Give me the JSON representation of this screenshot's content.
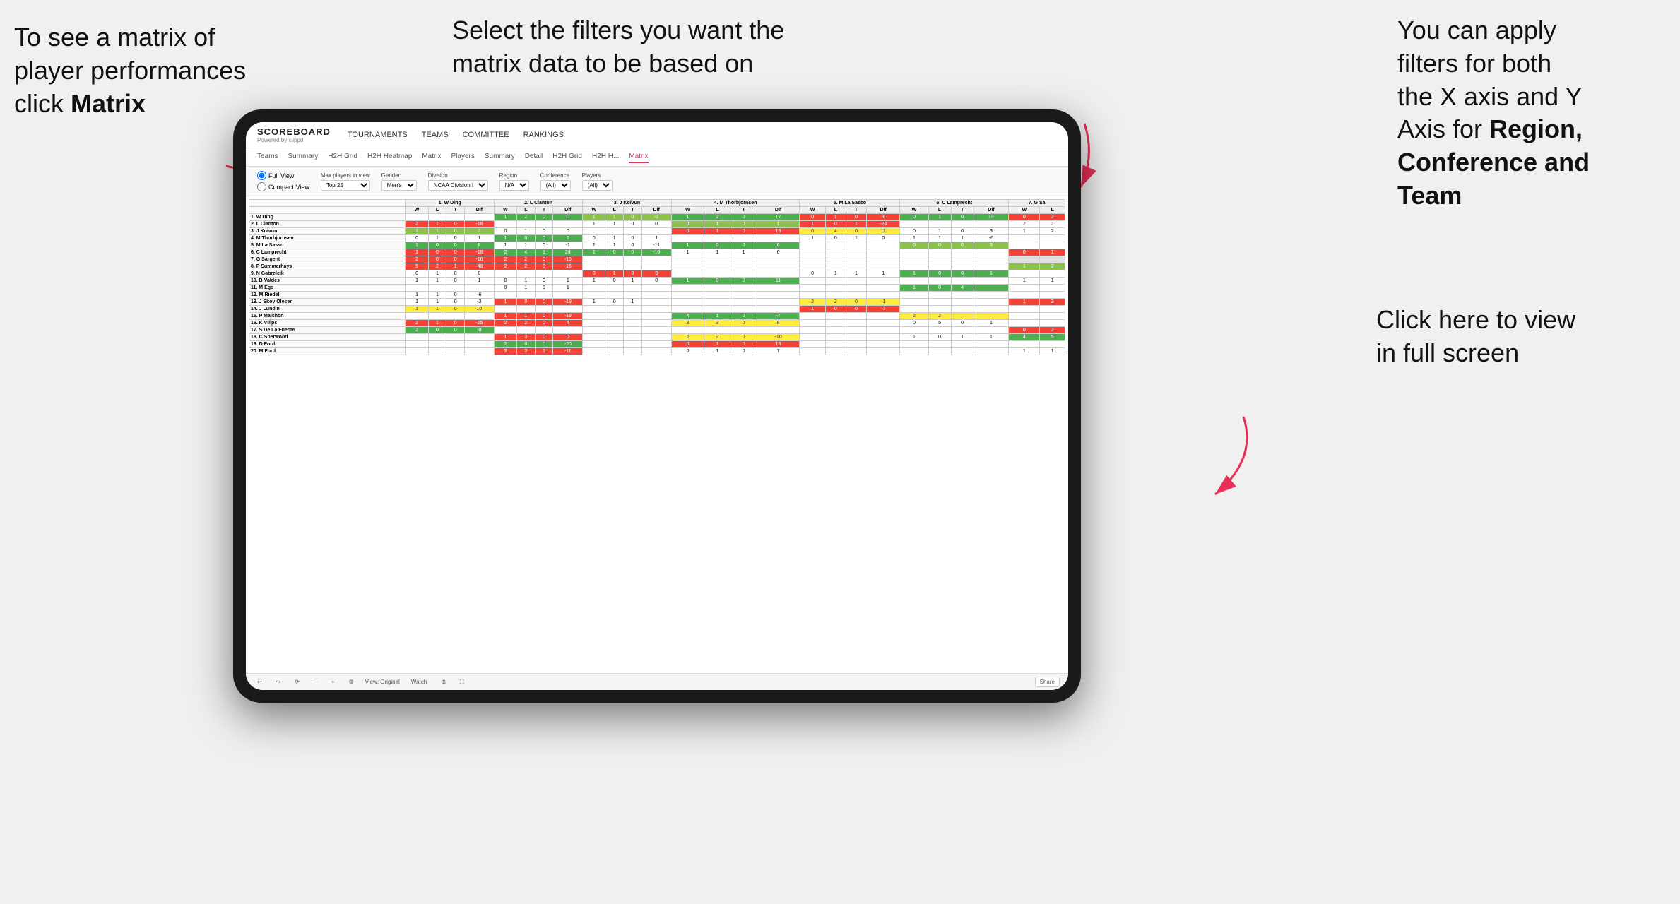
{
  "annotations": {
    "left": {
      "line1": "To see a matrix of",
      "line2": "player performances",
      "line3_normal": "click ",
      "line3_bold": "Matrix"
    },
    "center": {
      "text": "Select the filters you want the matrix data to be based on"
    },
    "right": {
      "line1": "You  can apply",
      "line2": "filters for both",
      "line3": "the X axis and Y",
      "line4_normal": "Axis for ",
      "line4_bold": "Region,",
      "line5_bold": "Conference and",
      "line6_bold": "Team"
    },
    "bottom_right": {
      "line1": "Click here to view",
      "line2": "in full screen"
    }
  },
  "nav": {
    "logo_title": "SCOREBOARD",
    "logo_subtitle": "Powered by clippd",
    "links": [
      "TOURNAMENTS",
      "TEAMS",
      "COMMITTEE",
      "RANKINGS"
    ]
  },
  "sub_nav": {
    "items": [
      "Teams",
      "Summary",
      "H2H Grid",
      "H2H Heatmap",
      "Matrix",
      "Players",
      "Summary",
      "Detail",
      "H2H Grid",
      "H2H H...",
      "Matrix"
    ],
    "active_index": 10
  },
  "filters": {
    "view_options": [
      "Full View",
      "Compact View"
    ],
    "max_players_label": "Max players in view",
    "max_players_value": "Top 25",
    "gender_label": "Gender",
    "gender_value": "Men's",
    "division_label": "Division",
    "division_value": "NCAA Division I",
    "region_label": "Region",
    "region_value": "N/A",
    "conference_label": "Conference",
    "conference_value": "(All)",
    "players_label": "Players",
    "players_value": "(All)"
  },
  "matrix": {
    "col_headers": [
      "1. W Ding",
      "2. L Clanton",
      "3. J Koivun",
      "4. M Thorbjornsen",
      "5. M La Sasso",
      "6. C Lamprecht",
      "7. G Sa"
    ],
    "sub_headers": [
      "W",
      "L",
      "T",
      "Dif"
    ],
    "rows": [
      {
        "name": "1. W Ding",
        "cells": [
          [
            null,
            null,
            null
          ],
          [
            1,
            2,
            0,
            11
          ],
          [
            1,
            1,
            0,
            -2
          ],
          [
            1,
            2,
            0,
            17
          ],
          [
            0,
            1,
            0,
            -6
          ],
          [
            0,
            1,
            0,
            13
          ],
          [
            0,
            2
          ]
        ]
      },
      {
        "name": "2. L Clanton",
        "cells": [
          [
            2,
            1,
            0,
            -16
          ],
          [
            null,
            null,
            null
          ],
          [
            1,
            1,
            0,
            0
          ],
          [
            0,
            1,
            0,
            1
          ],
          [
            1,
            0,
            1,
            -24
          ],
          [
            null,
            null,
            null
          ],
          [
            2,
            2
          ]
        ]
      },
      {
        "name": "3. J Koivun",
        "cells": [
          [
            1,
            1,
            0,
            2
          ],
          [
            0,
            1,
            0,
            0
          ],
          [
            null,
            null,
            null
          ],
          [
            0,
            1,
            0,
            13
          ],
          [
            0,
            4,
            0,
            11
          ],
          [
            0,
            1,
            0,
            3
          ],
          [
            1,
            2
          ]
        ]
      },
      {
        "name": "4. M Thorbjornsen",
        "cells": [
          [
            0,
            1,
            0,
            1
          ],
          [
            1,
            0,
            0,
            1
          ],
          [
            0,
            1,
            0,
            1
          ],
          [
            null,
            null,
            null
          ],
          [
            1,
            0,
            1,
            0
          ],
          [
            1,
            1,
            1,
            0,
            -6
          ],
          [
            null
          ]
        ]
      },
      {
        "name": "5. M La Sasso",
        "cells": [
          [
            1,
            0,
            0,
            6
          ],
          [
            1,
            1,
            0,
            -1
          ],
          [
            1,
            1,
            0,
            -11
          ],
          [
            1,
            0,
            0,
            6
          ],
          [
            null,
            null,
            null
          ],
          [
            0,
            0,
            0,
            3
          ],
          [
            null
          ]
        ]
      },
      {
        "name": "6. C Lamprecht",
        "cells": [
          [
            1,
            0,
            0,
            -16
          ],
          [
            2,
            4,
            1,
            24
          ],
          [
            1,
            0,
            0,
            -16
          ],
          [
            1,
            1,
            1,
            6
          ],
          [
            null,
            null,
            null
          ],
          [
            null,
            null,
            null
          ],
          [
            0,
            1
          ]
        ]
      },
      {
        "name": "7. G Sargent",
        "cells": [
          [
            2,
            0,
            0,
            -16
          ],
          [
            2,
            2,
            0,
            -15
          ],
          [
            null
          ],
          [
            null
          ],
          [
            null
          ],
          [
            null
          ],
          [
            null
          ]
        ]
      },
      {
        "name": "8. P Summerhays",
        "cells": [
          [
            5,
            2,
            1,
            -48
          ],
          [
            2,
            2,
            0,
            -16
          ],
          [
            null
          ],
          [
            null
          ],
          [
            null
          ],
          [
            null
          ],
          [
            1,
            2
          ]
        ]
      },
      {
        "name": "9. N Gabrelcik",
        "cells": [
          [
            0,
            1,
            0,
            0
          ],
          [
            null
          ],
          [
            0,
            1,
            0,
            9
          ],
          [
            null
          ],
          [
            0,
            1,
            1,
            1
          ],
          [
            1,
            0,
            0,
            1
          ],
          [
            null
          ]
        ]
      },
      {
        "name": "10. B Valdes",
        "cells": [
          [
            1,
            1,
            0,
            1
          ],
          [
            0,
            1,
            0,
            1
          ],
          [
            1,
            0,
            1,
            0
          ],
          [
            1,
            0,
            0,
            11
          ],
          [
            null
          ],
          [
            null
          ],
          [
            1,
            1
          ]
        ]
      },
      {
        "name": "11. M Ege",
        "cells": [
          [
            null
          ],
          [
            0,
            1,
            0,
            1
          ],
          [
            0,
            null
          ],
          [
            null
          ],
          [
            null
          ],
          [
            1,
            0,
            4
          ],
          [
            null
          ]
        ]
      },
      {
        "name": "12. M Riedel",
        "cells": [
          [
            1,
            1,
            0,
            -6
          ],
          [
            null
          ],
          [
            null
          ],
          [
            null
          ],
          [
            null
          ],
          [
            null
          ],
          [
            null
          ]
        ]
      },
      {
        "name": "13. J Skov Olesen",
        "cells": [
          [
            1,
            1,
            0,
            -3
          ],
          [
            1,
            0,
            0,
            -19
          ],
          [
            1,
            0,
            1
          ],
          [
            null
          ],
          [
            2,
            2,
            0,
            -1
          ],
          [
            null
          ],
          [
            1,
            3
          ]
        ]
      },
      {
        "name": "14. J Lundin",
        "cells": [
          [
            1,
            1,
            0,
            10
          ],
          [
            null
          ],
          [
            null
          ],
          [
            null
          ],
          [
            1,
            0,
            0,
            -7
          ],
          [
            null
          ],
          [
            null
          ]
        ]
      },
      {
        "name": "15. P Maichon",
        "cells": [
          [
            null
          ],
          [
            1,
            1,
            0,
            -19
          ],
          [
            null
          ],
          [
            4,
            1,
            0,
            -7
          ],
          [
            null
          ],
          [
            2,
            2
          ],
          [
            null
          ]
        ]
      },
      {
        "name": "16. K Vilips",
        "cells": [
          [
            2,
            1,
            0,
            -25
          ],
          [
            2,
            2,
            0,
            4
          ],
          [
            null
          ],
          [
            3,
            3,
            0,
            8
          ],
          [
            null
          ],
          [
            0,
            5,
            0,
            1
          ],
          [
            null
          ]
        ]
      },
      {
        "name": "17. S De La Fuente",
        "cells": [
          [
            2,
            0,
            0,
            -8
          ],
          [
            null
          ],
          [
            null
          ],
          [
            null
          ],
          [
            null
          ],
          [
            null
          ],
          [
            0,
            2
          ]
        ]
      },
      {
        "name": "18. C Sherwood",
        "cells": [
          [
            null
          ],
          [
            1,
            3,
            0,
            0
          ],
          [
            null
          ],
          [
            2,
            2,
            0,
            -10
          ],
          [
            null
          ],
          [
            1,
            0,
            1,
            1
          ],
          [
            4,
            5
          ]
        ]
      },
      {
        "name": "19. D Ford",
        "cells": [
          [
            null
          ],
          [
            2,
            0,
            0,
            -20
          ],
          [
            null
          ],
          [
            0,
            1,
            0,
            13
          ],
          [
            null
          ],
          [
            null
          ],
          [
            null
          ]
        ]
      },
      {
        "name": "20. M Ford",
        "cells": [
          [
            null
          ],
          [
            3,
            3,
            1,
            -11
          ],
          [
            null
          ],
          [
            0,
            1,
            0,
            7
          ],
          [
            null
          ],
          [
            null
          ],
          [
            1,
            1
          ]
        ]
      }
    ]
  },
  "toolbar": {
    "view_label": "View: Original",
    "watch_label": "Watch",
    "share_label": "Share"
  },
  "colors": {
    "accent": "#e83058",
    "dark_green": "#2e7d32",
    "green": "#4caf50",
    "light_green": "#8bc34a",
    "yellow": "#ffeb3b",
    "orange": "#ff9800"
  }
}
